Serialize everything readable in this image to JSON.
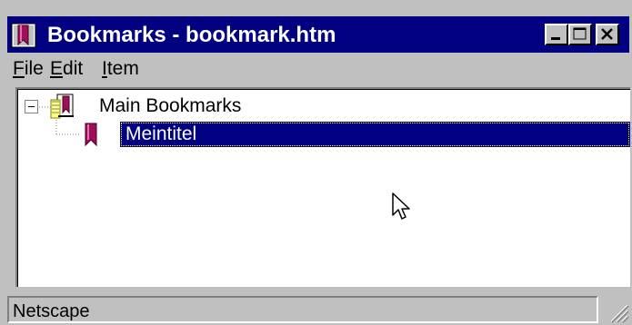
{
  "window": {
    "title": "Bookmarks - bookmark.htm",
    "app_icon": "bookmark-book-icon",
    "controls": [
      "minimize-icon",
      "maximize-icon",
      "close-icon"
    ]
  },
  "menu": {
    "items": [
      {
        "label_mnemonic": "F",
        "label_rest": "ile"
      },
      {
        "label_mnemonic": "E",
        "label_rest": "dit"
      },
      {
        "label_mnemonic": "I",
        "label_rest": "tem"
      }
    ]
  },
  "tree": {
    "root": {
      "label": "Main Bookmarks",
      "expanded": true,
      "icon": "bookmark-folder-icon"
    },
    "children": [
      {
        "label": "Meintitel",
        "selected": true,
        "icon": "bookmark-icon"
      }
    ]
  },
  "statusbar": {
    "text": "Netscape"
  },
  "colors": {
    "titlebar": "#000080",
    "selection": "#000080",
    "face": "#c0c0c0",
    "bookmark": "#a0105a"
  }
}
